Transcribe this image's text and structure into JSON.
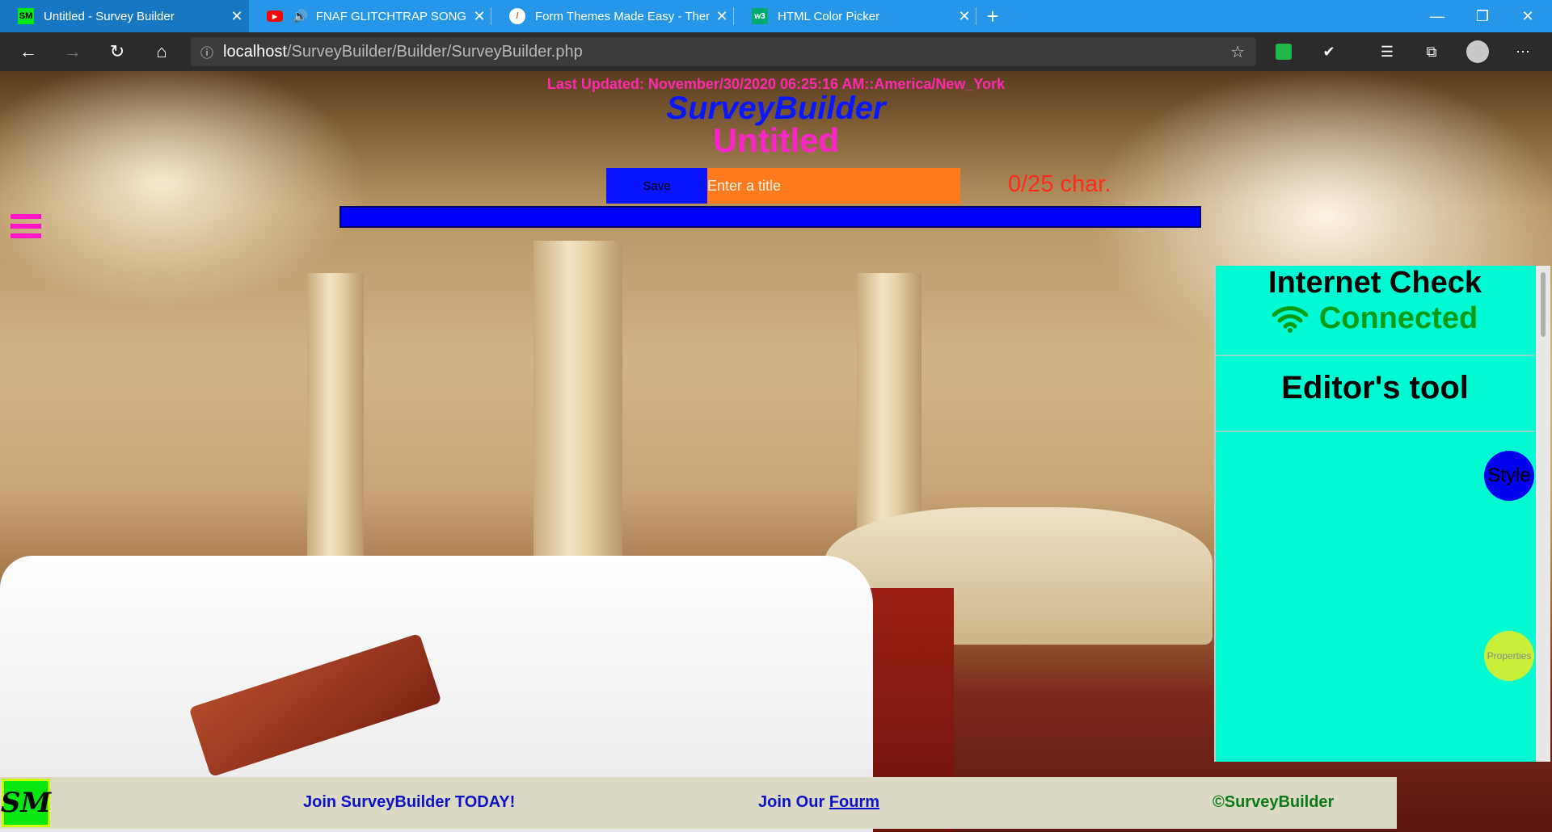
{
  "browser": {
    "tabs": [
      {
        "title": "Untitled - Survey Builder",
        "favicon": "sm-logo-icon",
        "active": true
      },
      {
        "title": "FNAF GLITCHTRAP SONG (",
        "favicon": "youtube-icon",
        "audio": true,
        "active": false
      },
      {
        "title": "Form Themes Made Easy - Them",
        "favicon": "form-icon",
        "active": false
      },
      {
        "title": "HTML Color Picker",
        "favicon": "w3-icon",
        "active": false
      }
    ],
    "new_tab_label": "+",
    "address": {
      "host": "localhost",
      "path": "/SurveyBuilder/Builder/SurveyBuilder.php"
    },
    "accent": "#2596e8"
  },
  "page": {
    "last_updated": "Last Updated: November/30/2020 06:25:16 AM::America/New_York",
    "app_title": "SurveyBuilder",
    "survey_title": "Untitled",
    "save_label": "Save",
    "title_placeholder": "Enter a title",
    "title_value": "",
    "char_count": "0/25 char.",
    "progress_fraction": 1.0
  },
  "side_panel": {
    "internet_heading": "Internet Check",
    "internet_status": "Connected",
    "status_icon": "wifi-icon",
    "editor_heading": "Editor's tool",
    "style_button": "Style",
    "properties_button": "Properties",
    "background": "#00fbd3"
  },
  "footer": {
    "logo_text": "SM",
    "join_text": "Join SurveyBuilder TODAY!",
    "forum_prefix": "Join Our ",
    "forum_link": "Fourm",
    "copyright": "©SurveyBuilder"
  }
}
